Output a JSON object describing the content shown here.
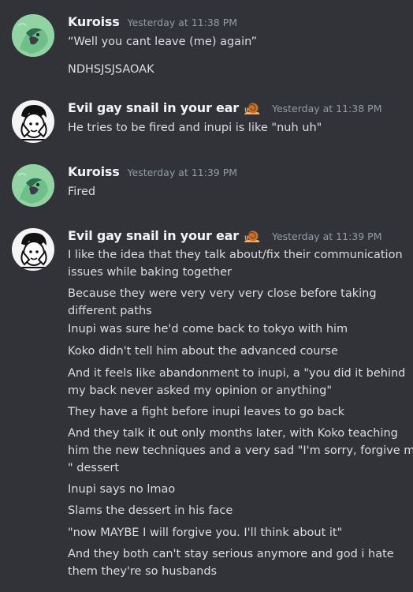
{
  "groups": [
    {
      "author": "Kuroiss",
      "timestamp": "Yesterday at 11:38 PM",
      "avatar": "kuroiss-avatar",
      "messages": [
        [
          "“Well you cant leave (me) again”"
        ],
        [
          "NDHSJSJSAOAK"
        ]
      ]
    },
    {
      "author": "Evil gay snail in your ear",
      "badge": "snail-icon",
      "timestamp": "Yesterday at 11:38 PM",
      "avatar": "snail-user-avatar",
      "messages": [
        [
          "He tries to be fired and inupi is like \"nuh uh\""
        ]
      ]
    },
    {
      "author": "Kuroiss",
      "timestamp": "Yesterday at 11:39 PM",
      "avatar": "kuroiss-avatar",
      "messages": [
        [
          "Fired"
        ]
      ]
    },
    {
      "author": "Evil gay snail in your ear",
      "badge": "snail-icon",
      "timestamp": "Yesterday at 11:39 PM",
      "avatar": "snail-user-avatar",
      "messages": [
        [
          "I like the idea that they talk about/fix their communication",
          "issues while baking together"
        ],
        [
          "Because they were very very very close before taking",
          "different paths"
        ],
        [
          "Inupi was sure he'd come back to tokyo with him"
        ],
        [
          "Koko didn't tell him about the advanced course"
        ],
        [
          "And it feels like abandonment to inupi, a \"you did it behind",
          "my back never asked my opinion or anything\""
        ],
        [
          "They have a fight before inupi leaves to go back"
        ],
        [
          "And they talk it out only months later, with Koko teaching",
          "him the new techniques and a very sad \"I'm sorry, forgive me?",
          "\" dessert"
        ],
        [
          "Inupi says no lmao"
        ],
        [
          "Slams the dessert in his face"
        ],
        [
          "\"now MAYBE I will forgive you. I'll think about it\""
        ],
        [
          "And they both can't stay serious anymore and god i hate",
          "them they're so husbands"
        ]
      ]
    }
  ],
  "colors": {
    "background": "#313338",
    "username": "#f2f3f5",
    "text": "#dbdee1",
    "timestamp": "#949ba4"
  }
}
